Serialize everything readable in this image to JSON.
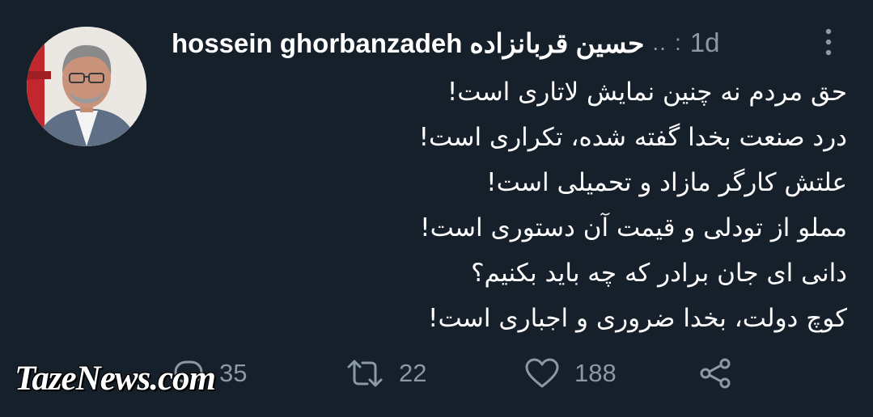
{
  "tweet": {
    "display_name": "hossein ghorbanzadeh حسین قربانزاده",
    "handle_truncated": "..",
    "separator": ":",
    "timestamp": "1d",
    "lines": [
      "حق مردم نه چنین نمایش لاتاری است!",
      "درد صنعت بخدا گفته شده، تکراری است!",
      "علتش کارگر مازاد و تحمیلی است!",
      "مملو از تودلی و قیمت آن دستوری است!",
      "دانی ای جان برادر که چه باید بکنیم؟",
      "کوچ دولت، بخدا ضروری و اجباری است!"
    ]
  },
  "actions": {
    "replies": "35",
    "retweets": "22",
    "likes": "188"
  },
  "icons": {
    "more": "more-vertical-icon",
    "reply": "reply-icon",
    "retweet": "retweet-icon",
    "like": "heart-icon",
    "share": "share-icon"
  },
  "watermark": "TazeNews.com",
  "colors": {
    "background": "#15202b",
    "text": "#ffffff",
    "muted": "#8b98a5"
  }
}
